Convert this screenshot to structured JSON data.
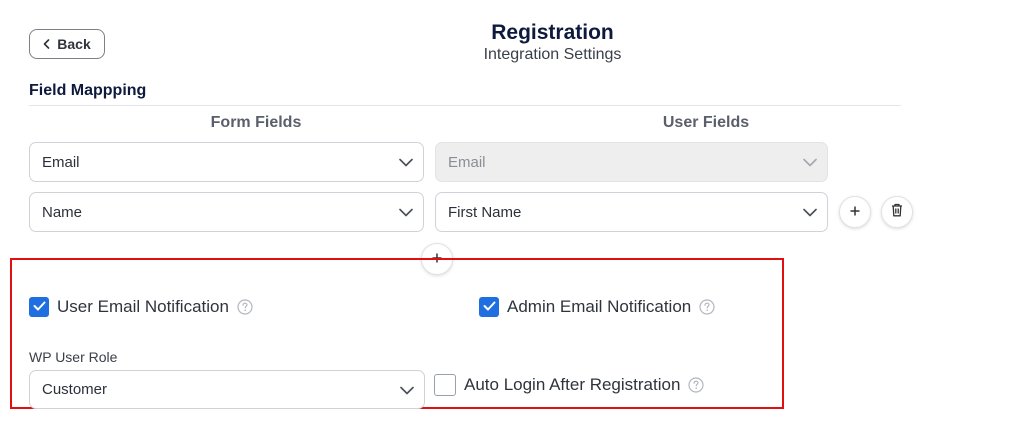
{
  "header": {
    "back_label": "Back",
    "title": "Registration",
    "subtitle": "Integration Settings"
  },
  "field_mapping": {
    "section_title": "Field Mappping",
    "form_fields_header": "Form Fields",
    "user_fields_header": "User Fields",
    "rows": [
      {
        "form_field": "Email",
        "user_field": "Email",
        "user_field_disabled": true
      },
      {
        "form_field": "Name",
        "user_field": "First Name",
        "user_field_disabled": false
      }
    ]
  },
  "options": {
    "user_email_notification": {
      "label": "User Email Notification",
      "checked": true
    },
    "admin_email_notification": {
      "label": "Admin Email Notification",
      "checked": true
    },
    "auto_login": {
      "label": "Auto Login After Registration",
      "checked": false
    },
    "wp_user_role": {
      "label": "WP User Role",
      "value": "Customer"
    }
  },
  "colors": {
    "accent": "#1f6fe0",
    "highlight": "#e01010",
    "title": "#0e1a3d"
  },
  "icons": {
    "back": "chevron-left-icon",
    "select": "chevron-down-icon",
    "add": "plus-icon",
    "delete": "trash-icon",
    "help": "question-circle-icon"
  }
}
